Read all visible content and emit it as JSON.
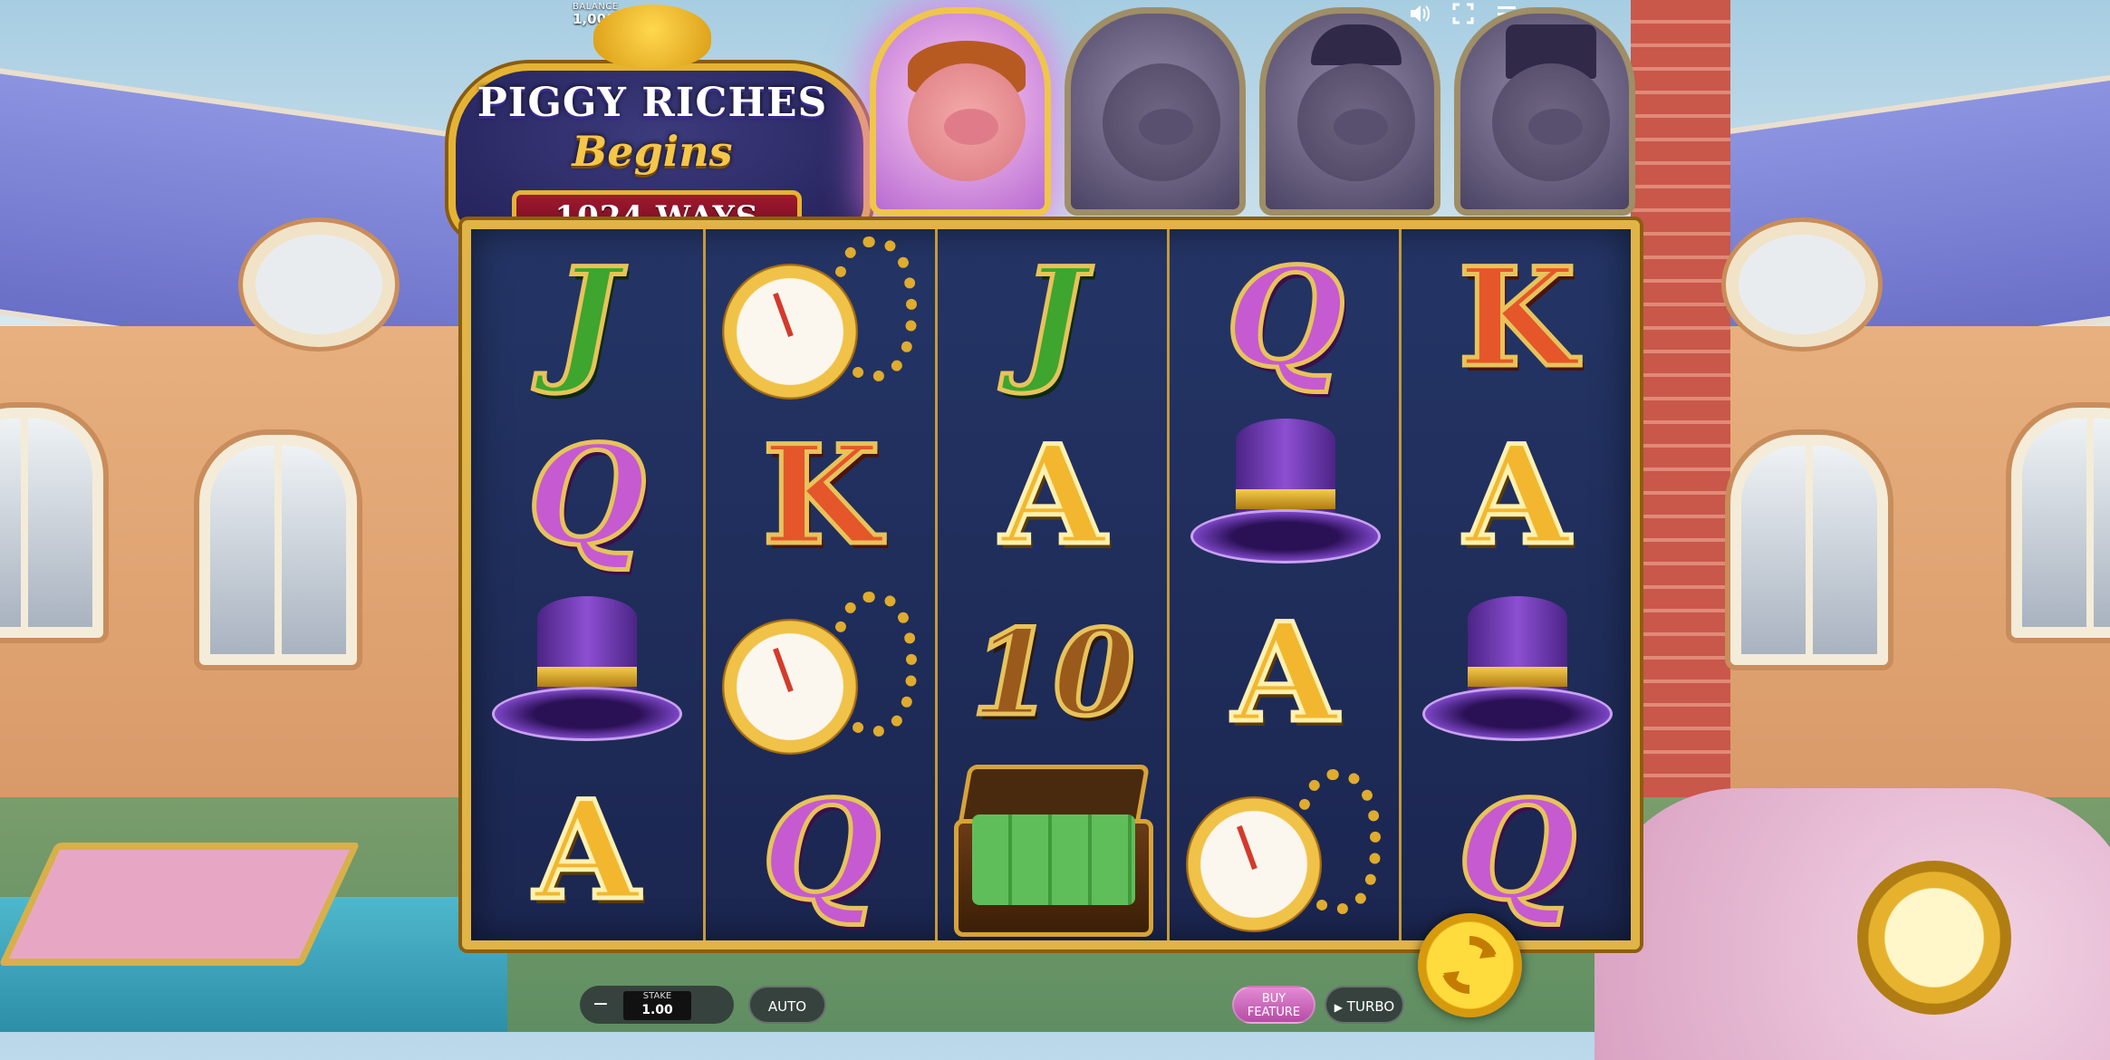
{
  "hud": {
    "balance_label": "BALANCE",
    "balance_value": "1,000.00",
    "icons": [
      "speaker-icon",
      "fullscreen-icon",
      "menu-icon"
    ]
  },
  "logo": {
    "line1": "PIGGY RICHES",
    "line2": "Begins",
    "ways": "1024 WAYS"
  },
  "characters": [
    {
      "name": "pig-redhead",
      "active": true
    },
    {
      "name": "pig-banker",
      "active": false
    },
    {
      "name": "pig-bowler-hat",
      "active": false
    },
    {
      "name": "pig-top-hat",
      "active": false
    }
  ],
  "reels": [
    [
      "J",
      "Q",
      "tophat",
      "A"
    ],
    [
      "watch",
      "K",
      "watch",
      "Q"
    ],
    [
      "J",
      "A",
      "10",
      "briefcase"
    ],
    [
      "Q",
      "tophat",
      "A",
      "watch"
    ],
    [
      "K",
      "A",
      "tophat",
      "Q"
    ]
  ],
  "controls": {
    "minus": "−",
    "stake_label": "STAKE",
    "stake_value": "1.00",
    "plus": "",
    "auto": "AUTO",
    "buy_feature": "BUY FEATURE",
    "turbo": "TURBO"
  },
  "colors": {
    "frame_gold": "#e0b446",
    "reel_bg": "#243566",
    "spin_button": "#ffdc3d"
  }
}
